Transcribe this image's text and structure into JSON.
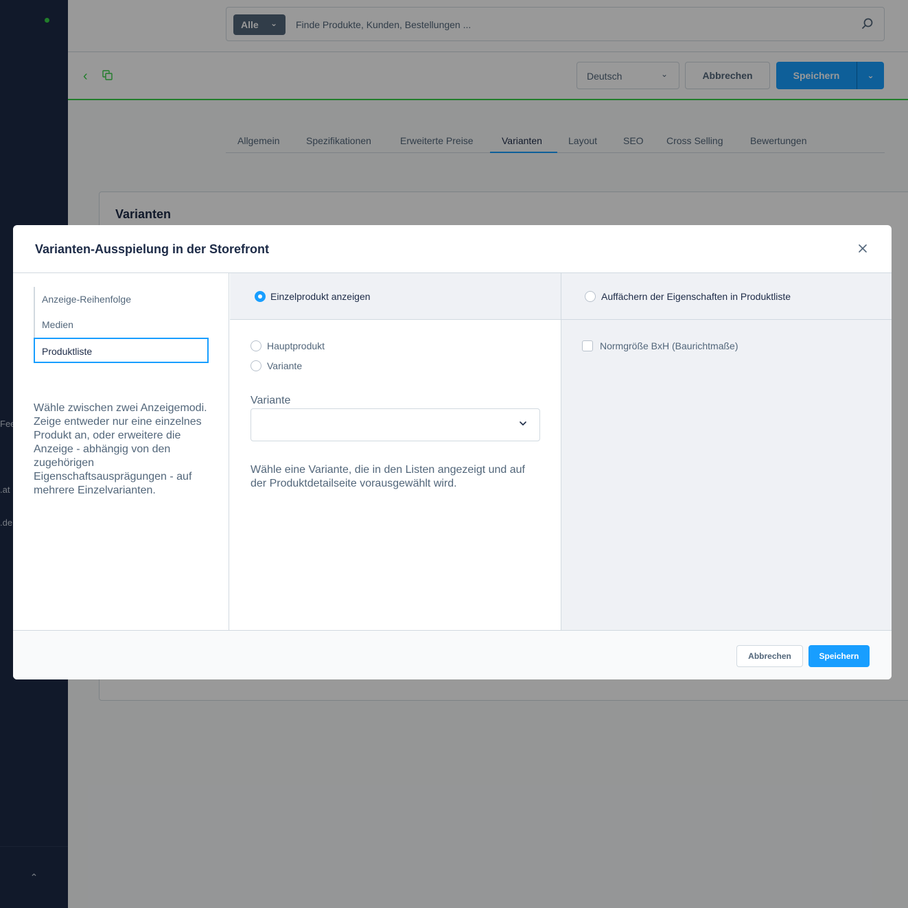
{
  "sidebar": {
    "side_texts": [
      "Fee",
      ".at",
      ".de"
    ],
    "collapse_icon": "chevron-up-icon"
  },
  "search": {
    "type_label": "Alle",
    "placeholder": "Finde Produkte, Kunden, Bestellungen ..."
  },
  "smartbar": {
    "language": "Deutsch",
    "abort_label": "Abbrechen",
    "save_label": "Speichern"
  },
  "tabs": [
    {
      "label": "Allgemein"
    },
    {
      "label": "Spezifikationen"
    },
    {
      "label": "Erweiterte Preise"
    },
    {
      "label": "Varianten",
      "active": true
    },
    {
      "label": "Layout"
    },
    {
      "label": "SEO"
    },
    {
      "label": "Cross Selling"
    },
    {
      "label": "Bewertungen"
    }
  ],
  "card": {
    "title": "Varianten"
  },
  "modal": {
    "title": "Varianten-Ausspielung in der Storefront",
    "nav": [
      {
        "label": "Anzeige-Reihenfolge"
      },
      {
        "label": "Medien"
      },
      {
        "label": "Produktliste",
        "active": true
      }
    ],
    "description": "Wähle zwischen zwei Anzeigemodi. Zeige entweder nur eine einzelnes Produkt an, oder erweitere die Anzeige - abhängig von den zugehörigen Eigenschaftsausprägungen - auf mehrere Einzelvarianten.",
    "mode_single": "Einzelprodukt anzeigen",
    "mode_expand": "Auffächern der Eigenschaften in Produktliste",
    "options": [
      {
        "label": "Hauptprodukt"
      },
      {
        "label": "Variante"
      }
    ],
    "variant_field_label": "Variante",
    "variant_field_value": "",
    "help_text": "Wähle eine Variante, die in den Listen angezeigt und auf der Produktdetailseite vorausgewählt wird.",
    "property_checkbox": "Normgröße BxH (Baurichtmaße)",
    "footer": {
      "abort_label": "Abbrechen",
      "save_label": "Speichern"
    }
  },
  "colors": {
    "accent": "#189eff",
    "sidebar": "#1d2b47",
    "status_green": "#37d046"
  }
}
